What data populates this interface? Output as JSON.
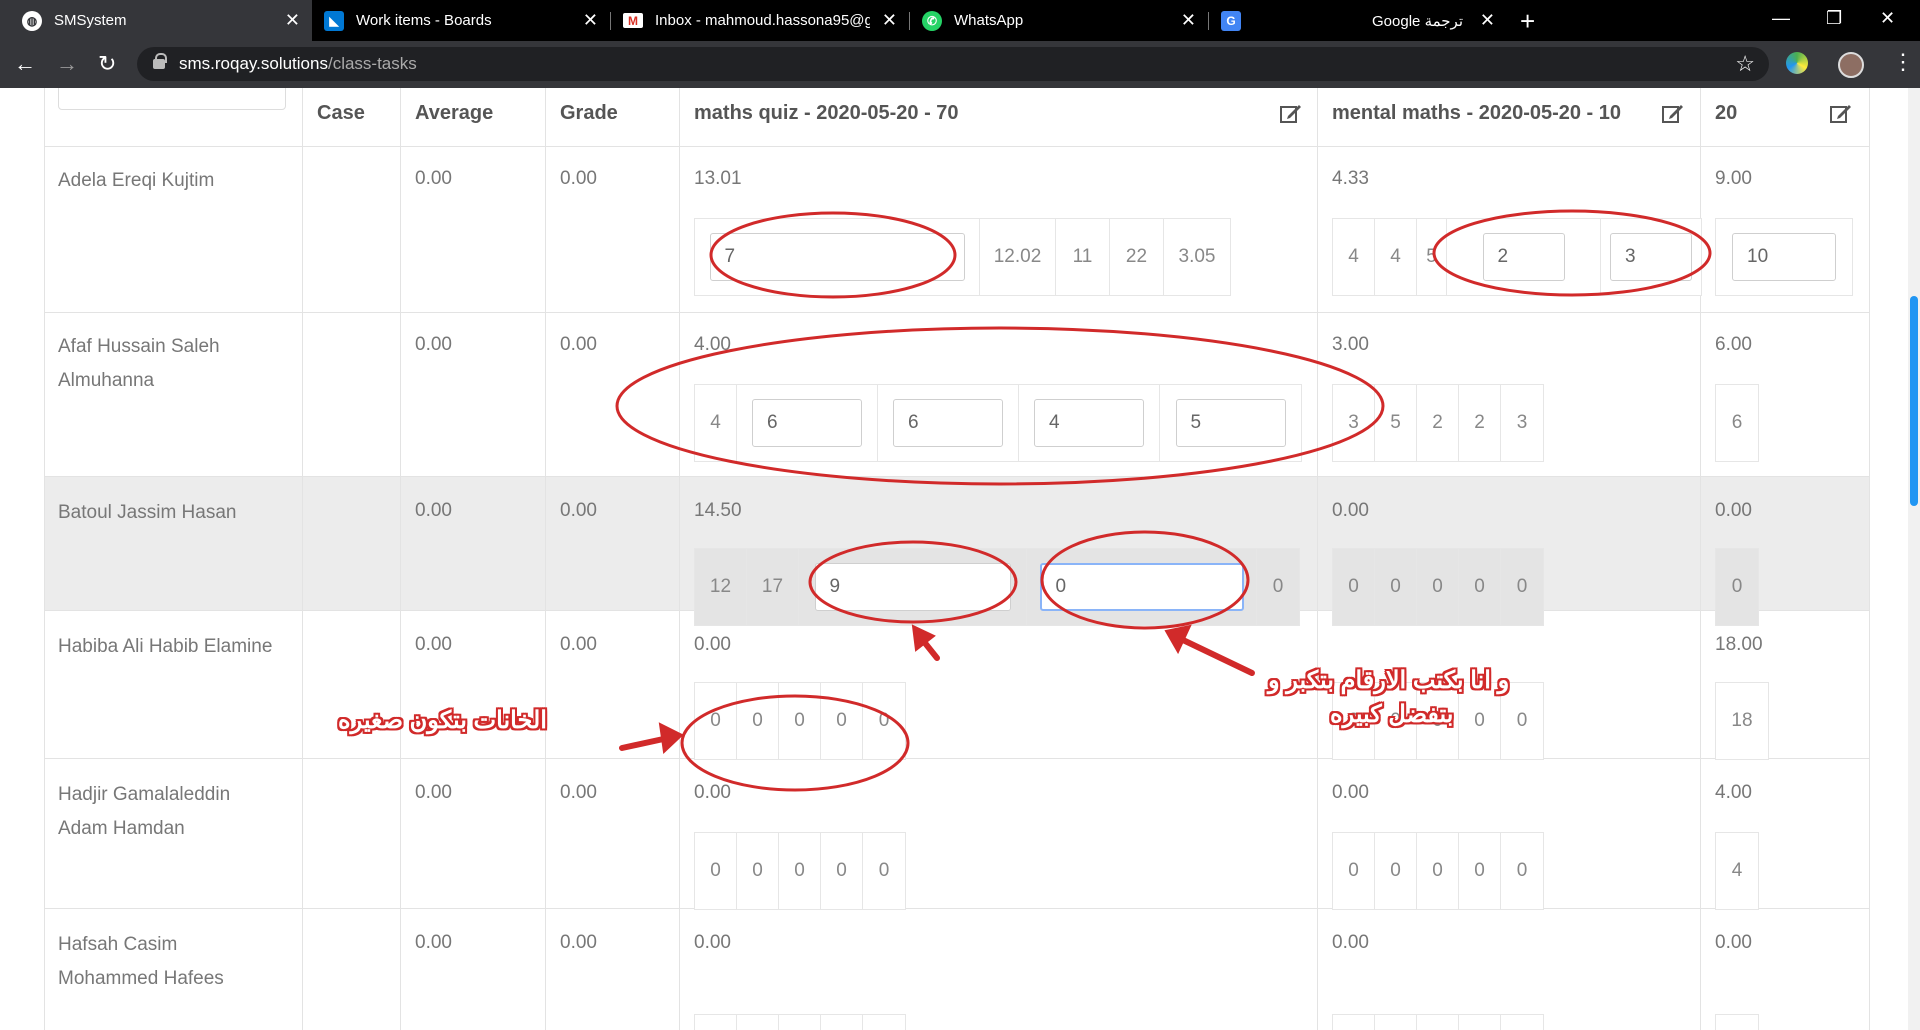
{
  "browser": {
    "tabs": [
      {
        "title": "SMSystem",
        "icon": "globe-icon"
      },
      {
        "title": "Work items - Boards",
        "icon": "azure-devops-icon"
      },
      {
        "title": "Inbox - mahmoud.hassona95@g",
        "icon": "gmail-icon"
      },
      {
        "title": "WhatsApp",
        "icon": "whatsapp-icon"
      },
      {
        "title": "Google ترجمة",
        "icon": "google-translate-icon"
      }
    ],
    "url_host": "sms.roqay.solutions",
    "url_path": "/class-tasks"
  },
  "table": {
    "headers": {
      "case": "Case",
      "average": "Average",
      "grade": "Grade",
      "task1": "maths quiz - 2020-05-20 - 70",
      "task2": "mental maths - 2020-05-20 - 10",
      "task3": "20"
    },
    "rows": [
      {
        "name": "Adela Ereqi Kujtim",
        "average": "0.00",
        "grade": "0.00",
        "t1_total": "13.01",
        "t1_cells": [
          "7",
          "12.02",
          "11",
          "22",
          "3.05"
        ],
        "t2_total": "4.33",
        "t2_cells": [
          "4",
          "4",
          "5",
          "2",
          "3"
        ],
        "t3_total": "9.00",
        "t3_cells": [
          "10"
        ]
      },
      {
        "name_line1": "Afaf Hussain Saleh",
        "name_line2": "Almuhanna",
        "average": "0.00",
        "grade": "0.00",
        "t1_total": "4.00",
        "t1_cells": [
          "4",
          "6",
          "6",
          "4",
          "5"
        ],
        "t2_total": "3.00",
        "t2_cells": [
          "3",
          "5",
          "2",
          "2",
          "3"
        ],
        "t3_total": "6.00",
        "t3_cells": [
          "6"
        ]
      },
      {
        "name": "Batoul Jassim Hasan",
        "average": "0.00",
        "grade": "0.00",
        "t1_total": "14.50",
        "t1_cells": [
          "12",
          "17",
          "9",
          "0",
          "0"
        ],
        "t2_total": "0.00",
        "t2_cells": [
          "0",
          "0",
          "0",
          "0",
          "0"
        ],
        "t3_total": "0.00",
        "t3_cells": [
          "0"
        ]
      },
      {
        "name": "Habiba Ali Habib Elamine",
        "average": "0.00",
        "grade": "0.00",
        "t1_total": "0.00",
        "t1_cells": [
          "0",
          "0",
          "0",
          "0",
          "0"
        ],
        "t2_total": "",
        "t2_cells": [
          "0",
          "0",
          "0",
          "0",
          "0"
        ],
        "t3_total": "18.00",
        "t3_cells": [
          "18"
        ]
      },
      {
        "name_line1": "Hadjir Gamalaleddin",
        "name_line2": "Adam Hamdan",
        "average": "0.00",
        "grade": "0.00",
        "t1_total": "0.00",
        "t1_cells": [
          "0",
          "0",
          "0",
          "0",
          "0"
        ],
        "t2_total": "0.00",
        "t2_cells": [
          "0",
          "0",
          "0",
          "0",
          "0"
        ],
        "t3_total": "4.00",
        "t3_cells": [
          "4"
        ]
      },
      {
        "name_line1": "Hafsah Casim",
        "name_line2": "Mohammed Hafees",
        "average": "0.00",
        "grade": "0.00",
        "t1_total": "0.00",
        "t2_total": "0.00",
        "t3_total": "0.00"
      }
    ]
  },
  "annotations": {
    "small_cells_note": "الخانات بتكون صغيره",
    "typing_note_line1": "و انا بكتب الارقام بتكبر و",
    "typing_note_line2": "بتفضل كبيره",
    "annotation_color": "#d12a2a"
  }
}
